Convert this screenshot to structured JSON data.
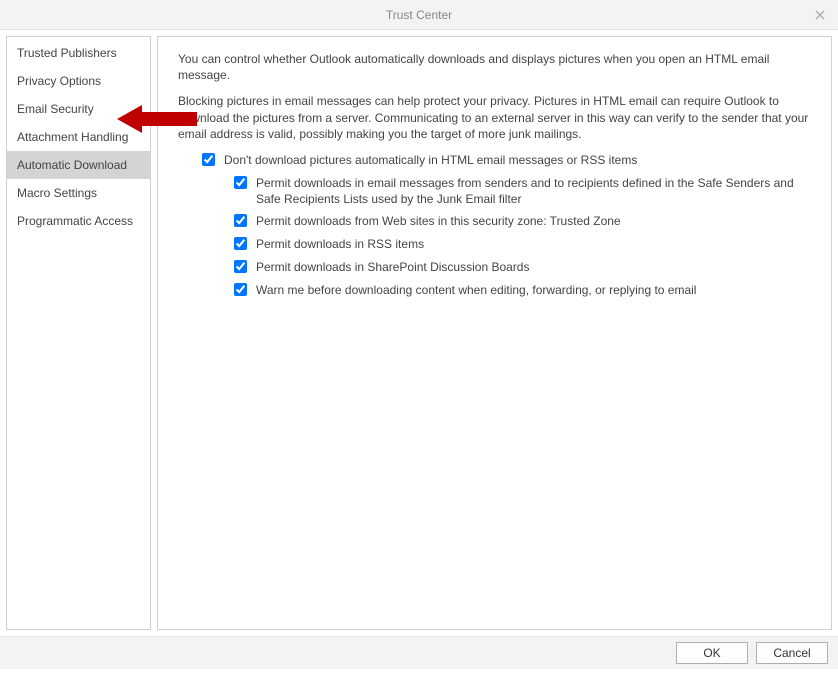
{
  "window": {
    "title": "Trust Center"
  },
  "sidebar": {
    "items": [
      {
        "label": "Trusted Publishers"
      },
      {
        "label": "Privacy Options"
      },
      {
        "label": "Email Security"
      },
      {
        "label": "Attachment Handling"
      },
      {
        "label": "Automatic Download"
      },
      {
        "label": "Macro Settings"
      },
      {
        "label": "Programmatic Access"
      }
    ],
    "selected_index": 4,
    "arrow_points_to_index": 2
  },
  "main": {
    "para1": "You can control whether Outlook automatically downloads and displays pictures when you open an HTML email message.",
    "para2": "Blocking pictures in email messages can help protect your privacy. Pictures in HTML email can require Outlook to download the pictures from a server. Communicating to an external server in this way can verify to the sender that your email address is valid, possibly making you the target of more junk mailings.",
    "options": [
      {
        "level": 1,
        "checked": true,
        "label": "Don't download pictures automatically in HTML email messages or RSS items"
      },
      {
        "level": 2,
        "checked": true,
        "label": "Permit downloads in email messages from senders and to recipients defined in the Safe Senders and Safe Recipients Lists used by the Junk Email filter"
      },
      {
        "level": 2,
        "checked": true,
        "label": "Permit downloads from Web sites in this security zone: Trusted Zone"
      },
      {
        "level": 2,
        "checked": true,
        "label": "Permit downloads in RSS items"
      },
      {
        "level": 2,
        "checked": true,
        "label": "Permit downloads in SharePoint Discussion Boards"
      },
      {
        "level": 2,
        "checked": true,
        "label": "Warn me before downloading content when editing, forwarding, or replying to email"
      }
    ]
  },
  "footer": {
    "ok": "OK",
    "cancel": "Cancel"
  }
}
